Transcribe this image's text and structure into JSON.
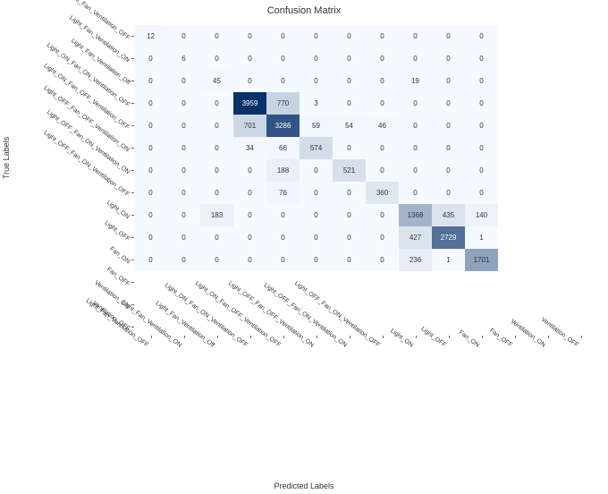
{
  "chart_data": {
    "type": "heatmap",
    "title": "Confusion Matrix",
    "ylabel": "True Labels",
    "xlabel": "Predicted Labels",
    "row_labels": [
      "Light_Fan_Ventilation_OFF",
      "Light_Fan_Ventilation_ON",
      "Light_Fan_Ventilation_Off",
      "Light_ON_Fan_ON_Ventilation_OFF",
      "Light_ON_Fan_OFF_Ventilation_OFF",
      "Light_OFF_Fan_OFF_Ventilation_ON",
      "Light_OFF_Fan_ON_Ventilation_ON",
      "Light_OFF_Fan_ON_Ventilation_OFF",
      "Light_ON",
      "Light_OFF",
      "Fan_ON",
      "Fan_OFF",
      "Ventilation_ON",
      "Ventilation_OFF"
    ],
    "col_labels": [
      "Light_Fan_Ventilation_OFF",
      "Light_Fan_Ventilation_ON",
      "Light_Fan_Ventilation_Off",
      "Light_ON_Fan_ON_Ventilation_OFF",
      "Light_ON_Fan_OFF_Ventilation_OFF",
      "Light_OFF_Fan_OFF_Ventilation_ON",
      "Light_OFF_Fan_ON_Ventilation_ON",
      "Light_OFF_Fan_ON_Ventilation_OFF",
      "Light_ON",
      "Light_OFF",
      "Fan_ON",
      "Fan_OFF",
      "Ventilation_ON",
      "Ventilation_OFF"
    ],
    "matrix": [
      [
        12,
        0,
        0,
        0,
        0,
        0,
        0,
        0,
        0,
        0,
        0,
        null,
        null,
        null
      ],
      [
        0,
        6,
        0,
        0,
        0,
        0,
        0,
        0,
        0,
        0,
        0,
        null,
        null,
        null
      ],
      [
        0,
        0,
        45,
        0,
        0,
        0,
        0,
        0,
        19,
        0,
        0,
        null,
        null,
        null
      ],
      [
        0,
        0,
        0,
        3959,
        770,
        3,
        0,
        0,
        0,
        0,
        0,
        null,
        null,
        null
      ],
      [
        0,
        0,
        0,
        701,
        3286,
        59,
        54,
        46,
        0,
        0,
        0,
        null,
        null,
        null
      ],
      [
        0,
        0,
        0,
        34,
        66,
        574,
        0,
        0,
        0,
        0,
        0,
        null,
        null,
        null
      ],
      [
        0,
        0,
        0,
        0,
        188,
        0,
        521,
        0,
        0,
        0,
        0,
        null,
        null,
        null
      ],
      [
        0,
        0,
        0,
        0,
        76,
        0,
        0,
        360,
        0,
        0,
        0,
        null,
        null,
        null
      ],
      [
        0,
        0,
        183,
        0,
        0,
        0,
        0,
        0,
        1368,
        435,
        140,
        null,
        null,
        null
      ],
      [
        0,
        0,
        0,
        0,
        0,
        0,
        0,
        0,
        427,
        2729,
        1,
        null,
        null,
        null
      ],
      [
        0,
        0,
        0,
        0,
        0,
        0,
        0,
        0,
        236,
        1,
        1701,
        null,
        null,
        null
      ],
      [
        null,
        null,
        null,
        null,
        null,
        null,
        null,
        null,
        null,
        null,
        null,
        null,
        null,
        null
      ],
      [
        null,
        null,
        null,
        null,
        null,
        null,
        null,
        null,
        null,
        null,
        null,
        null,
        null,
        null
      ],
      [
        null,
        null,
        null,
        null,
        null,
        null,
        null,
        null,
        null,
        null,
        null,
        null,
        null,
        null
      ]
    ],
    "vmin": 0,
    "vmax": 3959
  }
}
